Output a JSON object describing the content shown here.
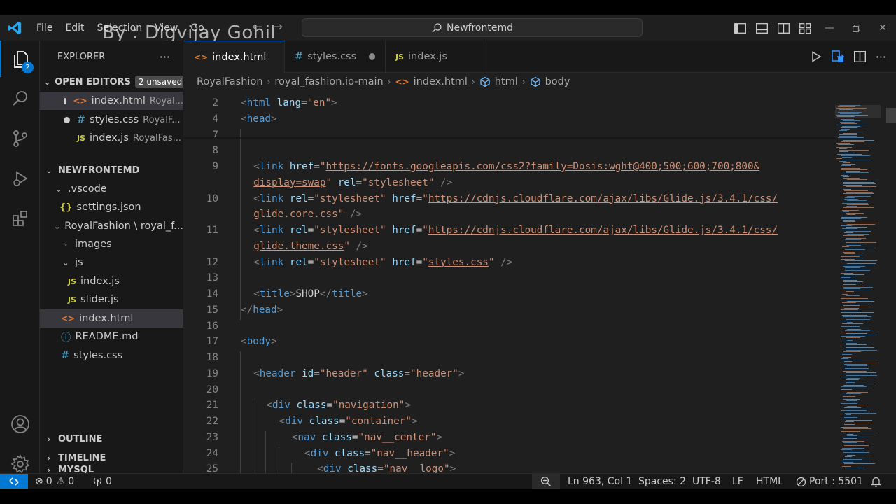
{
  "watermark": "By : Digvijay Gohil",
  "menu": [
    "File",
    "Edit",
    "Selection",
    "View",
    "Go"
  ],
  "command_center": "Newfrontemd",
  "activity": {
    "explorer_badge": "2"
  },
  "sidebar": {
    "title": "EXPLORER",
    "more": "···",
    "open_editors": {
      "label": "OPEN EDITORS",
      "badge": "2 unsaved"
    },
    "open_files": [
      {
        "name": "index.html",
        "path": "Royal...",
        "icon": "html-file-icon",
        "dirty": true
      },
      {
        "name": "styles.css",
        "path": "RoyalF...",
        "icon": "css-file-icon",
        "dirty": true
      },
      {
        "name": "index.js",
        "path": "RoyalFas...",
        "icon": "js-file-icon",
        "dirty": false
      }
    ],
    "workspace": "NEWFRONTEMD",
    "tree": [
      {
        "name": ".vscode",
        "type": "folder"
      },
      {
        "name": "settings.json",
        "type": "json"
      },
      {
        "name": "RoyalFashion \\ royal_f...",
        "type": "folder"
      },
      {
        "name": "images",
        "type": "folder-closed"
      },
      {
        "name": "js",
        "type": "folder"
      },
      {
        "name": "index.js",
        "type": "js"
      },
      {
        "name": "slider.js",
        "type": "js"
      },
      {
        "name": "index.html",
        "type": "html"
      },
      {
        "name": "README.md",
        "type": "info"
      },
      {
        "name": "styles.css",
        "type": "css"
      }
    ],
    "outline": "OUTLINE",
    "timeline": "TIMELINE",
    "mysql": "MYSQL"
  },
  "tabs": [
    {
      "label": "index.html",
      "icon": "<>",
      "dirty": true,
      "active": true
    },
    {
      "label": "styles.css",
      "icon": "#",
      "dirty": true,
      "active": false
    },
    {
      "label": "index.js",
      "icon": "JS",
      "dirty": false,
      "active": false
    }
  ],
  "breadcrumb": [
    "RoyalFashion",
    "royal_fashion.io-main",
    "index.html",
    "html",
    "body"
  ],
  "code_lines": [
    {
      "n": "2",
      "indent": 0,
      "tokens": [
        [
          "br",
          "<"
        ],
        [
          "tag",
          "html"
        ],
        [
          "tx",
          " "
        ],
        [
          "at",
          "lang"
        ],
        [
          "tx",
          "="
        ],
        [
          "st",
          "\"en\""
        ],
        [
          "br",
          ">"
        ]
      ]
    },
    {
      "n": "4",
      "indent": 0,
      "tokens": [
        [
          "br",
          "<"
        ],
        [
          "tag",
          "head"
        ],
        [
          "br",
          ">"
        ]
      ]
    },
    {
      "n": "7",
      "indent": 1,
      "tokens": []
    },
    {
      "n": "8",
      "indent": 1,
      "tokens": []
    },
    {
      "n": "9",
      "indent": 1,
      "tokens": [
        [
          "br",
          "<"
        ],
        [
          "tag",
          "link"
        ],
        [
          "tx",
          " "
        ],
        [
          "at",
          "href"
        ],
        [
          "tx",
          "="
        ],
        [
          "st",
          "\""
        ],
        [
          "stu",
          "https://fonts.googleapis.com/css2?family=Dosis:wght@400;500;600;700;800&"
        ]
      ]
    },
    {
      "n": "",
      "indent": 1,
      "tokens": [
        [
          "stu",
          "display=swap"
        ],
        [
          "st",
          "\""
        ],
        [
          "tx",
          " "
        ],
        [
          "at",
          "rel"
        ],
        [
          "tx",
          "="
        ],
        [
          "st",
          "\"stylesheet\""
        ],
        [
          "tx",
          " "
        ],
        [
          "br",
          "/>"
        ]
      ]
    },
    {
      "n": "10",
      "indent": 1,
      "tokens": [
        [
          "br",
          "<"
        ],
        [
          "tag",
          "link"
        ],
        [
          "tx",
          " "
        ],
        [
          "at",
          "rel"
        ],
        [
          "tx",
          "="
        ],
        [
          "st",
          "\"stylesheet\""
        ],
        [
          "tx",
          " "
        ],
        [
          "at",
          "href"
        ],
        [
          "tx",
          "="
        ],
        [
          "st",
          "\""
        ],
        [
          "stu",
          "https://cdnjs.cloudflare.com/ajax/libs/Glide.js/3.4.1/css/"
        ]
      ]
    },
    {
      "n": "",
      "indent": 1,
      "tokens": [
        [
          "stu",
          "glide.core.css"
        ],
        [
          "st",
          "\""
        ],
        [
          "tx",
          " "
        ],
        [
          "br",
          "/>"
        ]
      ]
    },
    {
      "n": "11",
      "indent": 1,
      "tokens": [
        [
          "br",
          "<"
        ],
        [
          "tag",
          "link"
        ],
        [
          "tx",
          " "
        ],
        [
          "at",
          "rel"
        ],
        [
          "tx",
          "="
        ],
        [
          "st",
          "\"stylesheet\""
        ],
        [
          "tx",
          " "
        ],
        [
          "at",
          "href"
        ],
        [
          "tx",
          "="
        ],
        [
          "st",
          "\""
        ],
        [
          "stu",
          "https://cdnjs.cloudflare.com/ajax/libs/Glide.js/3.4.1/css/"
        ]
      ]
    },
    {
      "n": "",
      "indent": 1,
      "tokens": [
        [
          "stu",
          "glide.theme.css"
        ],
        [
          "st",
          "\""
        ],
        [
          "tx",
          " "
        ],
        [
          "br",
          "/>"
        ]
      ]
    },
    {
      "n": "12",
      "indent": 1,
      "tokens": [
        [
          "br",
          "<"
        ],
        [
          "tag",
          "link"
        ],
        [
          "tx",
          " "
        ],
        [
          "at",
          "rel"
        ],
        [
          "tx",
          "="
        ],
        [
          "st",
          "\"stylesheet\""
        ],
        [
          "tx",
          " "
        ],
        [
          "at",
          "href"
        ],
        [
          "tx",
          "="
        ],
        [
          "st",
          "\""
        ],
        [
          "stu",
          "styles.css"
        ],
        [
          "st",
          "\""
        ],
        [
          "tx",
          " "
        ],
        [
          "br",
          "/>"
        ]
      ]
    },
    {
      "n": "13",
      "indent": 1,
      "tokens": []
    },
    {
      "n": "14",
      "indent": 1,
      "tokens": [
        [
          "br",
          "<"
        ],
        [
          "tag",
          "title"
        ],
        [
          "br",
          ">"
        ],
        [
          "tx",
          "SHOP"
        ],
        [
          "br",
          "</"
        ],
        [
          "tag",
          "title"
        ],
        [
          "br",
          ">"
        ]
      ]
    },
    {
      "n": "15",
      "indent": 0,
      "tokens": [
        [
          "br",
          "</"
        ],
        [
          "tag",
          "head"
        ],
        [
          "br",
          ">"
        ]
      ]
    },
    {
      "n": "16",
      "indent": 0,
      "tokens": []
    },
    {
      "n": "17",
      "indent": 0,
      "tokens": [
        [
          "br",
          "<"
        ],
        [
          "tag",
          "body"
        ],
        [
          "br",
          ">"
        ]
      ]
    },
    {
      "n": "18",
      "indent": 1,
      "tokens": []
    },
    {
      "n": "19",
      "indent": 1,
      "tokens": [
        [
          "br",
          "<"
        ],
        [
          "tag",
          "header"
        ],
        [
          "tx",
          " "
        ],
        [
          "at",
          "id"
        ],
        [
          "tx",
          "="
        ],
        [
          "st",
          "\"header\""
        ],
        [
          "tx",
          " "
        ],
        [
          "at",
          "class"
        ],
        [
          "tx",
          "="
        ],
        [
          "st",
          "\"header\""
        ],
        [
          "br",
          ">"
        ]
      ]
    },
    {
      "n": "20",
      "indent": 2,
      "tokens": []
    },
    {
      "n": "21",
      "indent": 2,
      "tokens": [
        [
          "br",
          "<"
        ],
        [
          "tag",
          "div"
        ],
        [
          "tx",
          " "
        ],
        [
          "at",
          "class"
        ],
        [
          "tx",
          "="
        ],
        [
          "st",
          "\"navigation\""
        ],
        [
          "br",
          ">"
        ]
      ]
    },
    {
      "n": "22",
      "indent": 3,
      "tokens": [
        [
          "br",
          "<"
        ],
        [
          "tag",
          "div"
        ],
        [
          "tx",
          " "
        ],
        [
          "at",
          "class"
        ],
        [
          "tx",
          "="
        ],
        [
          "st",
          "\"container\""
        ],
        [
          "br",
          ">"
        ]
      ]
    },
    {
      "n": "23",
      "indent": 4,
      "tokens": [
        [
          "br",
          "<"
        ],
        [
          "tag",
          "nav"
        ],
        [
          "tx",
          " "
        ],
        [
          "at",
          "class"
        ],
        [
          "tx",
          "="
        ],
        [
          "st",
          "\"nav__center\""
        ],
        [
          "br",
          ">"
        ]
      ]
    },
    {
      "n": "24",
      "indent": 5,
      "tokens": [
        [
          "br",
          "<"
        ],
        [
          "tag",
          "div"
        ],
        [
          "tx",
          " "
        ],
        [
          "at",
          "class"
        ],
        [
          "tx",
          "="
        ],
        [
          "st",
          "\"nav__header\""
        ],
        [
          "br",
          ">"
        ]
      ]
    },
    {
      "n": "25",
      "indent": 6,
      "tokens": [
        [
          "br",
          "<"
        ],
        [
          "tag",
          "div"
        ],
        [
          "tx",
          " "
        ],
        [
          "at",
          "class"
        ],
        [
          "tx",
          "="
        ],
        [
          "st",
          "\"nav__logo\""
        ],
        [
          "br",
          ">"
        ]
      ]
    }
  ],
  "status": {
    "errors": "0",
    "warnings": "0",
    "ports": "0",
    "position": "Ln 963, Col 1",
    "spaces": "Spaces: 2",
    "encoding": "UTF-8",
    "eol": "LF",
    "language": "HTML",
    "port": "Port : 5501"
  },
  "colors": {
    "accent": "#0078d4",
    "tag": "#569cd6",
    "attr": "#9cdcfe",
    "string": "#ce9178"
  }
}
